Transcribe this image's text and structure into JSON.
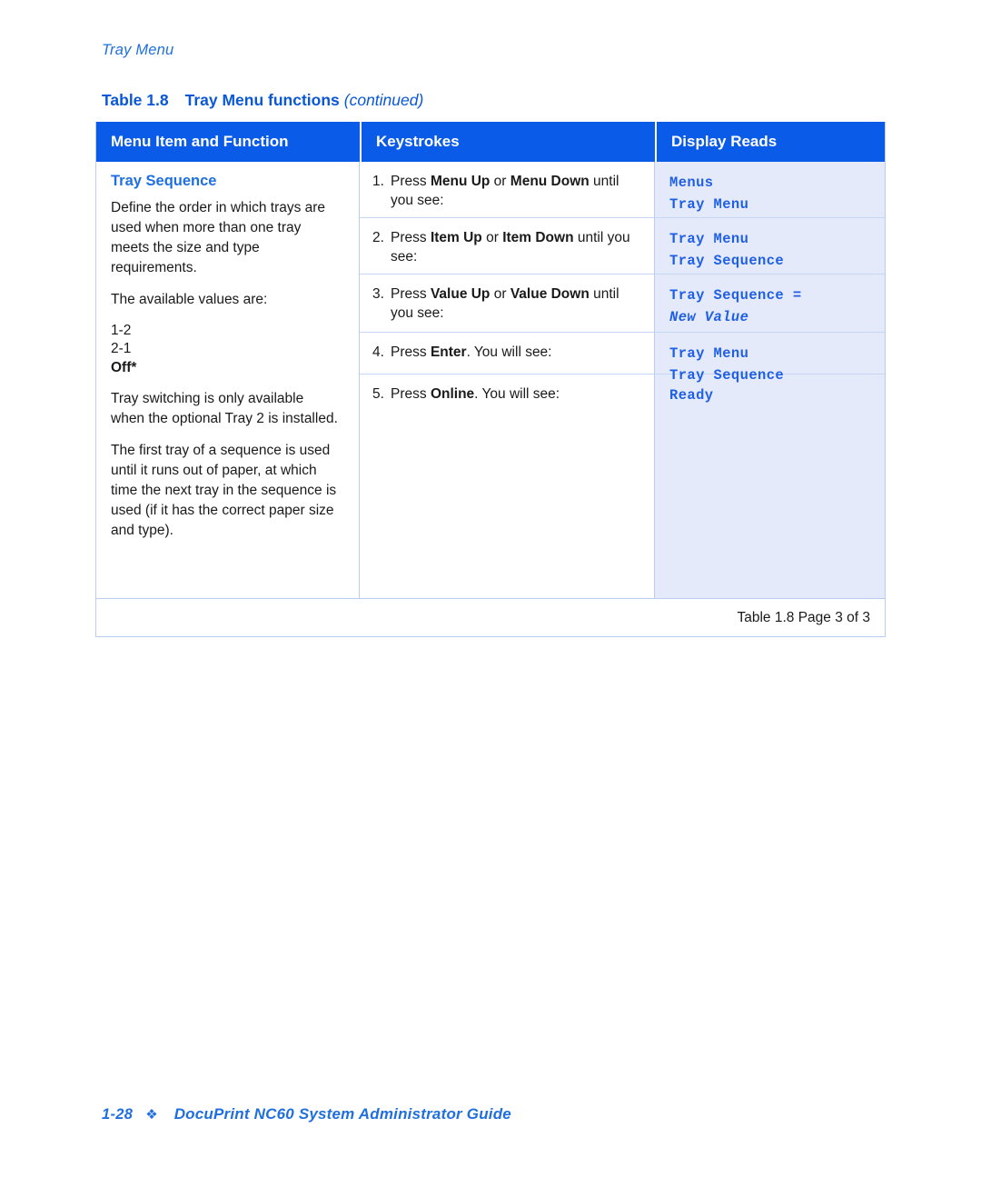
{
  "running_head": "Tray Menu",
  "caption": {
    "number": "Table 1.8",
    "title": "Tray Menu functions",
    "continued": "(continued)"
  },
  "table": {
    "headers": {
      "col1": "Menu Item and Function",
      "col2": "Keystrokes",
      "col3": "Display Reads"
    },
    "menu_item": {
      "title": "Tray Sequence",
      "para1": "Define the order in which trays are used when more than one tray meets the size and type requirements.",
      "para2": "The available values are:",
      "value1": "1-2",
      "value2": "2-1",
      "value3_default": "Off*",
      "para3": "Tray switching is only available when the optional Tray 2 is installed.",
      "para4": "The first tray of a sequence is used until it runs out of paper, at which time the next tray in the sequence is used (if it has the correct paper size and type)."
    },
    "steps": [
      {
        "num": "1.",
        "pre": "Press ",
        "key1": "Menu Up",
        "mid": " or ",
        "key2": "Menu Down",
        "post": " until you see:"
      },
      {
        "num": "2.",
        "pre": "Press ",
        "key1": "Item Up",
        "mid": " or ",
        "key2": "Item Down",
        "post": " until you see:"
      },
      {
        "num": "3.",
        "pre": "Press ",
        "key1": "Value Up",
        "mid": " or ",
        "key2": "Value Down",
        "post": " until you see:"
      },
      {
        "num": "4.",
        "pre": "Press ",
        "key1": "Enter",
        "mid": "",
        "key2": "",
        "post": ". You will see:"
      },
      {
        "num": "5.",
        "pre": "Press ",
        "key1": "Online",
        "mid": "",
        "key2": "",
        "post": ". You will see:"
      }
    ],
    "display_reads": [
      {
        "line1": "Menus",
        "line2": "Tray Menu",
        "line2_italic": false
      },
      {
        "line1": "Tray Menu",
        "line2": "Tray Sequence",
        "line2_italic": false
      },
      {
        "line1": "Tray Sequence  =",
        "line2": "New Value",
        "line2_italic": true
      },
      {
        "line1": "Tray Menu",
        "line2": "Tray Sequence",
        "line2_italic": false
      },
      {
        "line1": "Ready",
        "line2": "",
        "line2_italic": false
      }
    ],
    "table_footer": "Table 1.8  Page 3 of 3"
  },
  "page_footer": {
    "page_number": "1-28",
    "diamond": "❖",
    "title": "DocuPrint NC60 System Administrator Guide"
  },
  "colors": {
    "header_blue": "#0a5be8",
    "accent_blue": "#1f6fe0",
    "display_bg": "#e4eafa",
    "display_text": "#1f5fe6",
    "rule_blue": "#b9cdf2"
  }
}
